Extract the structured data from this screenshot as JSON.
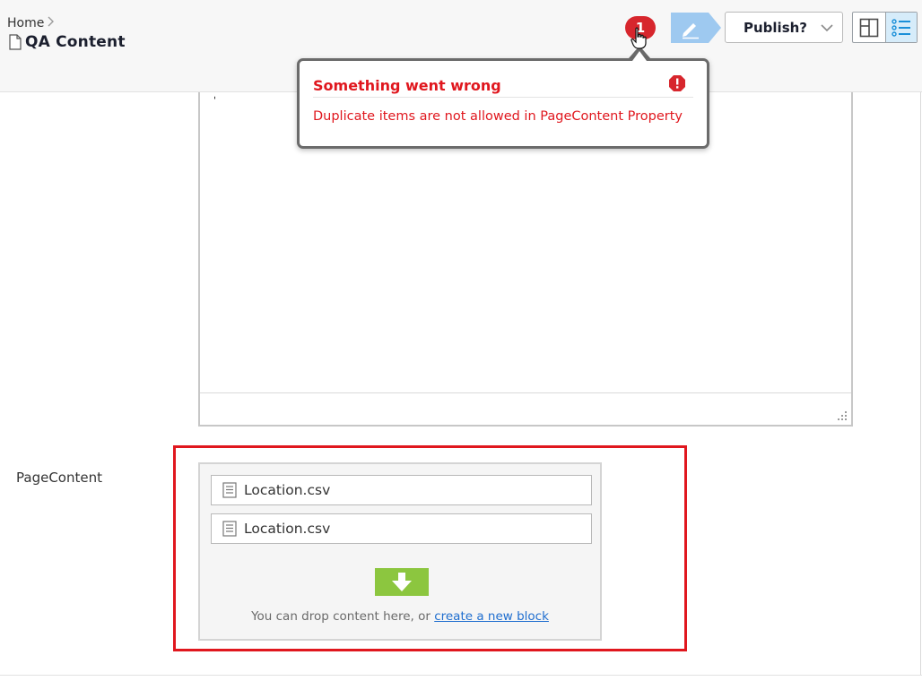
{
  "header": {
    "breadcrumb": "Home",
    "title": "QA Content",
    "notification_count": "1",
    "publish_label": "Publish?"
  },
  "popover": {
    "title": "Something went wrong",
    "message": "Duplicate items are not allowed in PageContent Property"
  },
  "editor": {
    "fragment": "̩"
  },
  "page_content": {
    "label": "PageContent",
    "items": [
      {
        "name": "Location.csv"
      },
      {
        "name": "Location.csv"
      }
    ],
    "drop_hint": "You can drop content here, or",
    "create_link": "create a new block"
  },
  "colors": {
    "error": "#e0171e",
    "accent_green": "#8cc63f",
    "edit_blue": "#9ec9f0"
  }
}
